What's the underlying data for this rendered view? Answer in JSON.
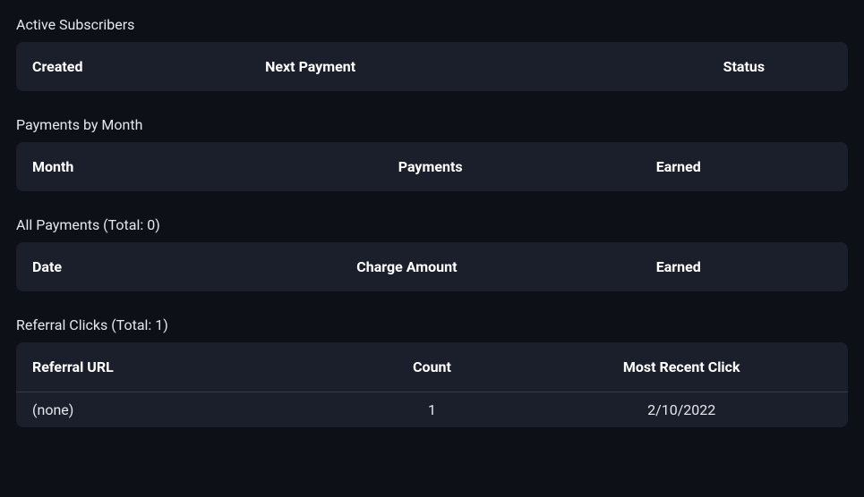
{
  "sections": {
    "active_subscribers": {
      "title": "Active Subscribers",
      "headers": [
        "Created",
        "Next Payment",
        "Status"
      ]
    },
    "payments_by_month": {
      "title": "Payments by Month",
      "headers": [
        "Month",
        "Payments",
        "Earned"
      ]
    },
    "all_payments": {
      "title": "All Payments (Total: 0)",
      "headers": [
        "Date",
        "Charge Amount",
        "Earned"
      ]
    },
    "referral_clicks": {
      "title": "Referral Clicks (Total: 1)",
      "headers": [
        "Referral URL",
        "Count",
        "Most Recent Click"
      ],
      "rows": [
        {
          "url": "(none)",
          "count": "1",
          "recent": "2/10/2022"
        }
      ]
    }
  }
}
